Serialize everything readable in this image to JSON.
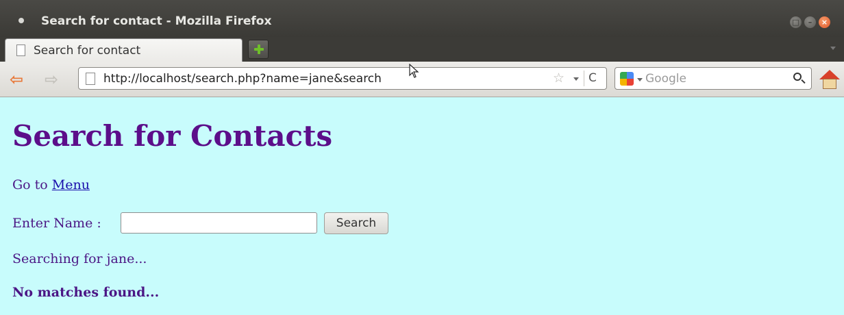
{
  "window": {
    "title": "Search for contact - Mozilla Firefox",
    "close_glyph": "×",
    "minimize_glyph": "–",
    "maximize_glyph": "□"
  },
  "tabs": [
    {
      "label": "Search for contact",
      "active": true
    }
  ],
  "toolbar": {
    "url": "http://localhost/search.php?name=jane&search",
    "search_placeholder": "Google",
    "back_glyph": "⇦",
    "forward_glyph": "⇨",
    "star_glyph": "☆",
    "reload_glyph": "C"
  },
  "page": {
    "heading": "Search for Contacts",
    "goto_prefix": "Go to",
    "menu_link": "Menu",
    "enter_label": "Enter Name :",
    "name_value": "",
    "search_button": "Search",
    "searching_text": "Searching for jane...",
    "result_text": "No matches found..."
  },
  "colors": {
    "page_background": "#c8fcfc",
    "text_purple": "#4b1685",
    "heading_purple": "#5c0e8a",
    "link_blue": "#1a0dab"
  },
  "icons": {
    "title_dot": "app-dot-icon",
    "tab_page": "page-icon",
    "new_tab": "plus-icon",
    "url_page": "page-icon",
    "search_engine": "google-icon",
    "search": "magnifier-icon",
    "home": "home-icon"
  }
}
